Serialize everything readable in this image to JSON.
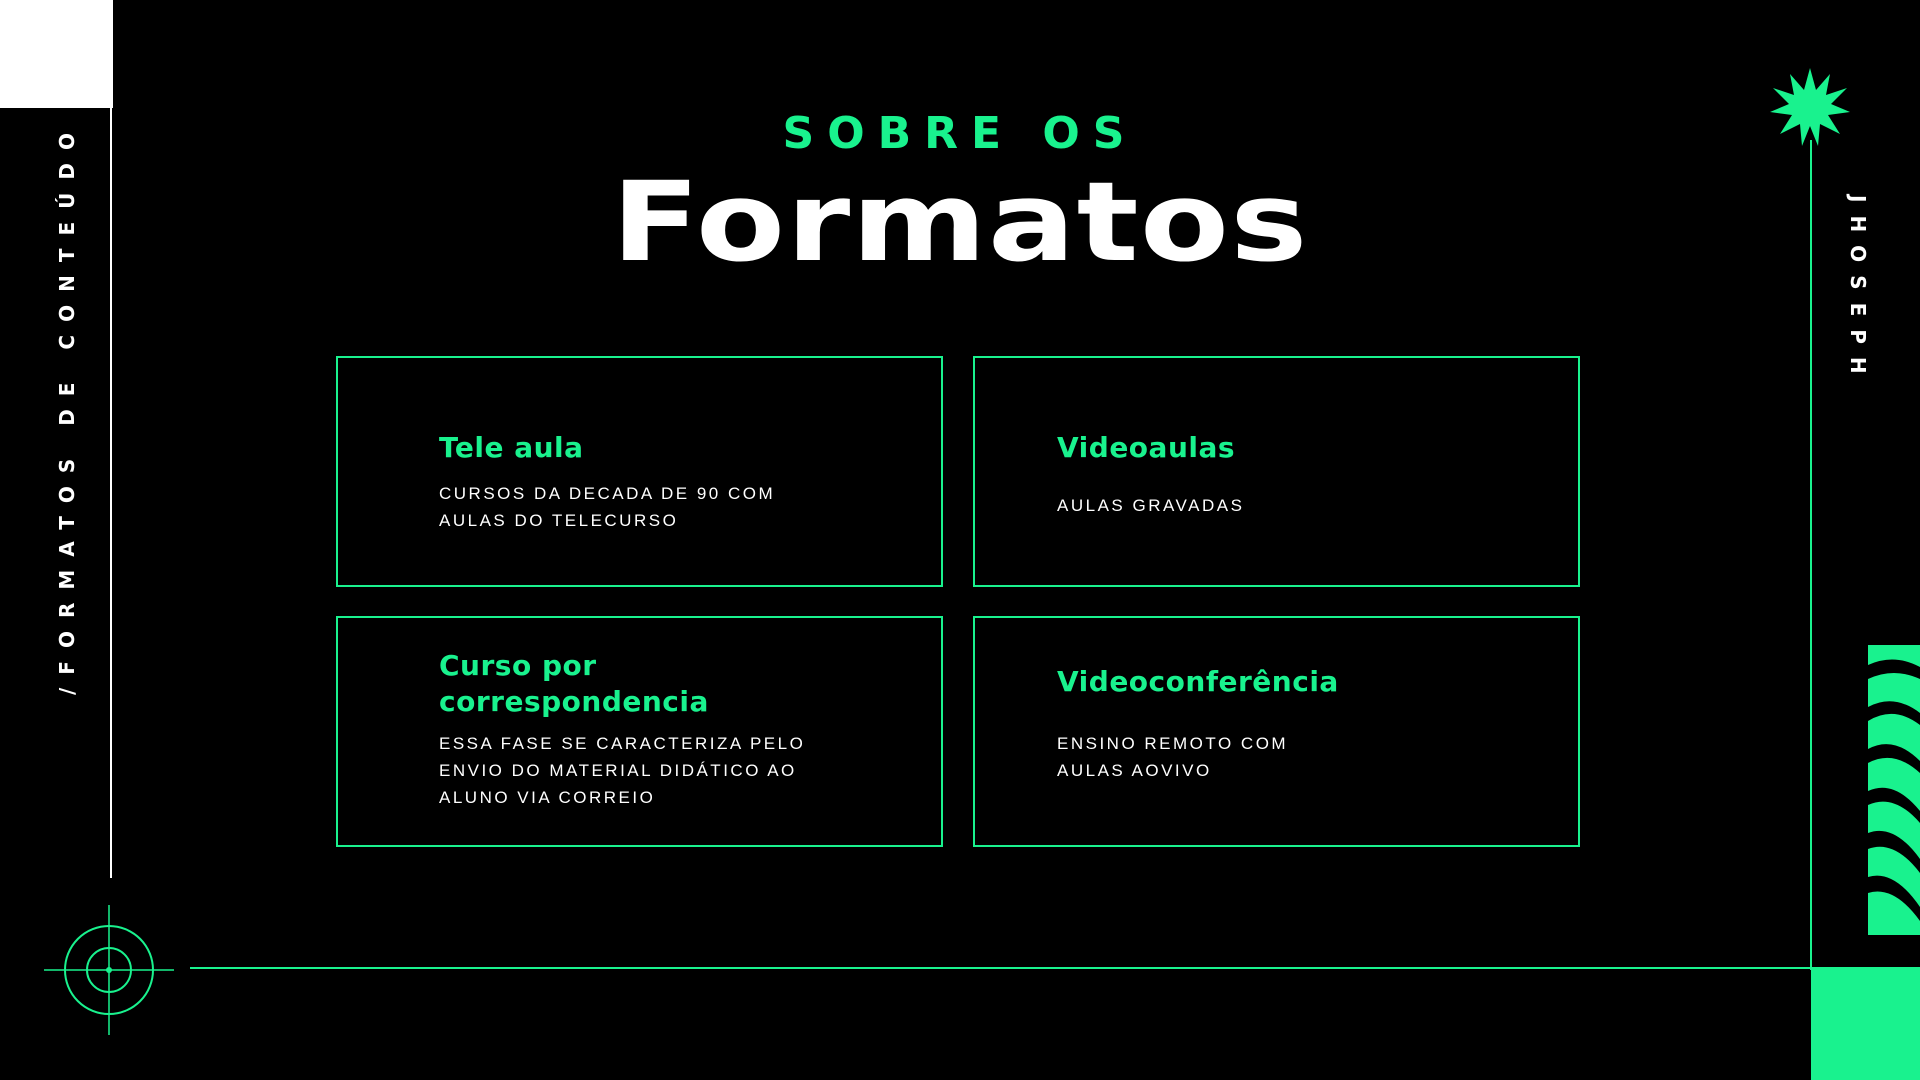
{
  "header": {
    "eyebrow": "SOBRE OS",
    "title": "Formatos"
  },
  "side_label": "/FORMATOS DE CONTEÚDO",
  "right_label": "JHOSEPH",
  "colors": {
    "accent": "#19f28e",
    "background": "#000000",
    "text": "#ffffff"
  },
  "cards": [
    {
      "title": "Tele aula",
      "description_lines": [
        "CURSOS DA DECADA DE 90 COM",
        "AULAS DO TELECURSO"
      ]
    },
    {
      "title": "Videoaulas",
      "description_lines": [
        "AULAS GRAVADAS"
      ]
    },
    {
      "title_lines": [
        "Curso por",
        "correspondencia"
      ],
      "description_lines": [
        "ESSA FASE SE CARACTERIZA PELO",
        "ENVIO DO MATERIAL DIDÁTICO AO",
        "ALUNO VIA CORREIO"
      ]
    },
    {
      "title": "Videoconferência",
      "description_lines": [
        "ENSINO REMOTO COM",
        "AULAS AOVIVO"
      ]
    }
  ],
  "icons": [
    "star-burst-icon",
    "crosshair-target-icon",
    "zigzag-stripes-decoration"
  ]
}
